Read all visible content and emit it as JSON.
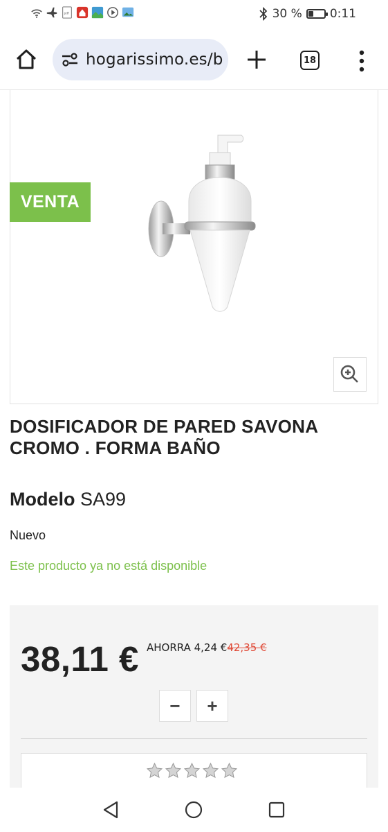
{
  "status_bar": {
    "battery_text": "30 %",
    "battery_level": 0.3,
    "time": "0:11",
    "icons": [
      "wifi-icon",
      "airplane-icon",
      "pdf-icon",
      "app-icon",
      "gallery-icon",
      "media-icon",
      "photos-icon",
      "bluetooth-icon",
      "battery-icon"
    ]
  },
  "browser": {
    "url": "hogarissimo.es/b",
    "tab_count": "18"
  },
  "product": {
    "sale_badge": "VENTA",
    "title": "DOSIFICADOR DE PARED SAVONA CROMO . FORMA BAÑO",
    "model_label": "Modelo",
    "model_value": "SA99",
    "condition": "Nuevo",
    "availability": "Este producto ya no está disponible",
    "price": "38,11 €",
    "savings_label": "AHORRA 4,24 €",
    "old_price": "42,35 €",
    "qty_minus": "−",
    "qty_plus": "+",
    "rating_stars": 5,
    "availability_color": "#7cc04b",
    "old_price_color": "#e04b38"
  }
}
